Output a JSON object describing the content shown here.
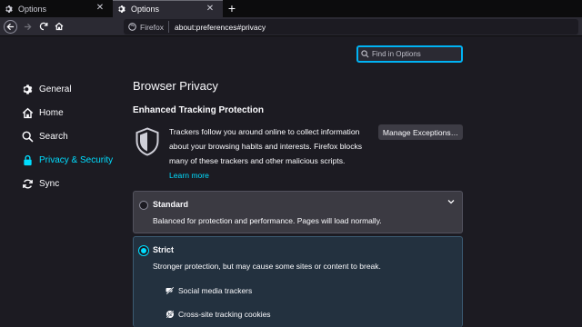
{
  "tabs": [
    {
      "label": "Options",
      "icon": "gear-icon",
      "active": false
    },
    {
      "label": "Options",
      "icon": "gear-icon",
      "active": true
    }
  ],
  "new_tab_icon": "plus-icon",
  "nav": {
    "identity_label": "Firefox",
    "url": "about:preferences#privacy"
  },
  "search": {
    "placeholder": "Find in Options"
  },
  "sidebar": {
    "items": [
      {
        "label": "General",
        "icon": "gear-icon"
      },
      {
        "label": "Home",
        "icon": "home-icon"
      },
      {
        "label": "Search",
        "icon": "search-icon"
      },
      {
        "label": "Privacy & Security",
        "icon": "lock-icon",
        "selected": true
      },
      {
        "label": "Sync",
        "icon": "sync-icon"
      }
    ]
  },
  "main": {
    "title": "Browser Privacy",
    "etp_heading": "Enhanced Tracking Protection",
    "etp_description": "Trackers follow you around online to collect information about your browsing habits and interests. Firefox blocks many of these trackers and other malicious scripts.",
    "learn_more": "Learn more",
    "manage_exceptions": "Manage Exceptions…"
  },
  "options": {
    "standard": {
      "title": "Standard",
      "description": "Balanced for protection and performance. Pages will load normally.",
      "selected": false
    },
    "strict": {
      "title": "Strict",
      "description": "Stronger protection, but may cause some sites or content to break.",
      "selected": true,
      "features": [
        "Social media trackers",
        "Cross-site tracking cookies"
      ]
    }
  },
  "colors": {
    "accent": "#00ddff",
    "background": "#1c1b22",
    "toolbar": "#2b2a33"
  }
}
